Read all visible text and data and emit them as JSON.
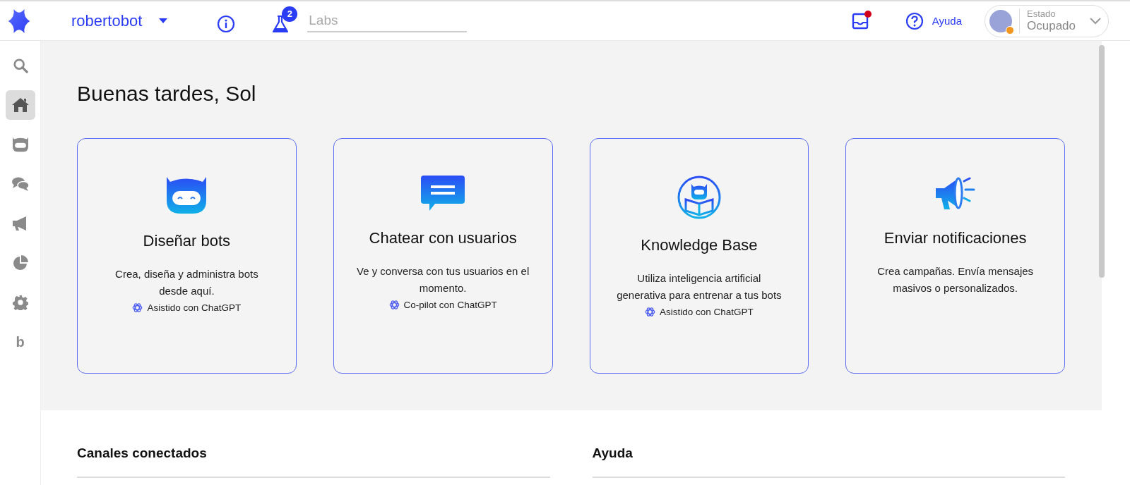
{
  "topbar": {
    "workspace": "robertobot",
    "labs_badge": "2",
    "labs_placeholder": "Labs",
    "notification_unread": true,
    "help_label": "Ayuda",
    "status": {
      "label": "Estado",
      "value": "Ocupado"
    }
  },
  "sidebar": {
    "items": [
      {
        "kind": "search",
        "selected": false
      },
      {
        "kind": "home",
        "selected": true
      },
      {
        "kind": "bot",
        "selected": false
      },
      {
        "kind": "chat",
        "selected": false
      },
      {
        "kind": "megaphone",
        "selected": false
      },
      {
        "kind": "pie",
        "selected": false
      },
      {
        "kind": "gear",
        "selected": false
      },
      {
        "kind": "letter",
        "label": "b",
        "selected": false
      }
    ]
  },
  "greeting": "Buenas tardes, Sol",
  "cards": [
    {
      "kind": "bot",
      "title": "Diseñar bots",
      "description": "Crea, diseña y administra bots desde aquí.",
      "ai_note": "Asistido con ChatGPT"
    },
    {
      "kind": "chat",
      "title": "Chatear con usuarios",
      "description": "Ve y conversa con tus usuarios en el momento.",
      "ai_note": "Co-pilot con ChatGPT"
    },
    {
      "kind": "knowledge",
      "title": "Knowledge Base",
      "description": "Utiliza inteligencia artificial generativa para entrenar a tus bots",
      "ai_note": "Asistido con ChatGPT"
    },
    {
      "kind": "megaphone",
      "title": "Enviar notificaciones",
      "description": "Crea campañas. Envía mensajes masivos o personalizados."
    }
  ],
  "sections": [
    {
      "title": "Canales conectados"
    },
    {
      "title": "Ayuda"
    }
  ]
}
